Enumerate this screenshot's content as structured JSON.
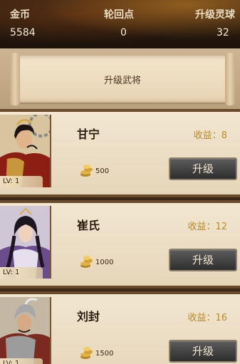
{
  "resources": {
    "gold": {
      "label": "金币",
      "value": "5584"
    },
    "cycle": {
      "label": "轮回点",
      "value": "0"
    },
    "lingshi": {
      "label": "升级灵球",
      "value": "32"
    }
  },
  "header": {
    "title": "升级武将"
  },
  "generals": [
    {
      "name": "甘宁",
      "income": "收益：8",
      "cost": "500",
      "level": "LV: 1",
      "upgrade_label": "升级"
    },
    {
      "name": "崔氏",
      "income": "收益：12",
      "cost": "1000",
      "level": "LV: 1",
      "upgrade_label": "升级"
    },
    {
      "name": "刘封",
      "income": "收益：16",
      "cost": "1500",
      "level": "LV: 1",
      "upgrade_label": "升级"
    }
  ],
  "colors": {
    "income_gold": "#b88a2c",
    "card_border": "#6b4a2c",
    "button_dark": "#2e2e2e"
  },
  "icons": {
    "cost": "gold-coin-stack-icon"
  }
}
